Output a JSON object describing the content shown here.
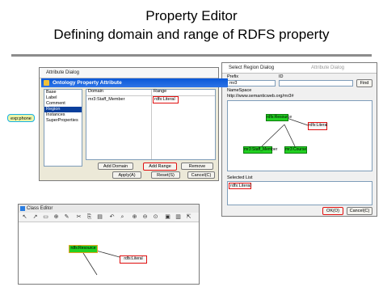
{
  "slide": {
    "title_line1": "Property Editor",
    "title_line2": "Defining domain and range of RDFS property"
  },
  "floating_node": {
    "label": "exp:phone"
  },
  "attribute_dialog": {
    "window_title": "Attribute Dialog",
    "header": "Ontology Property Attribute",
    "nav_items": [
      "Base",
      "Label",
      "Comment",
      "Region",
      "Instances",
      "SuperProperties"
    ],
    "selected_nav": "Region",
    "domain_header": "Domain",
    "range_header": "Range",
    "domain_value": "mr3:Staff_Member",
    "range_value": "rdfs:Literal",
    "buttons": {
      "add_domain": "Add Domain",
      "add_range": "Add Range",
      "remove": "Remove",
      "apply": "Apply(A)",
      "reset": "Reset(S)",
      "cancel": "Cancel(C)"
    }
  },
  "region_dialog": {
    "window_title": "Select Region Dialog",
    "inactive_title": "Attribute Dialog",
    "prefix_label": "Prefix",
    "id_label": "ID",
    "prefix_value": "mr3",
    "find_label": "Find",
    "namespace_label": "NameSpace",
    "namespace_value": "http://www.semanticweb.org/mr3#",
    "nodes": {
      "resource": "rdfs:Resource",
      "literal": "rdfs:Literal",
      "staff": "mr3:Staff_Member",
      "course": "mr3:Course"
    },
    "selected_list_label": "Selected List",
    "selected_item": "rdfs:Literal",
    "ok_label": "OK(O)",
    "cancel_label": "Cancel(C)"
  },
  "class_editor": {
    "window_title": "Class Editor",
    "nodes": {
      "resource": "rdfs:Resource",
      "literal": "rdfs:Literal"
    }
  },
  "colors": {
    "node_green": "#22d122",
    "highlight_red": "#e01010",
    "title_blue": "#0a58d8"
  }
}
